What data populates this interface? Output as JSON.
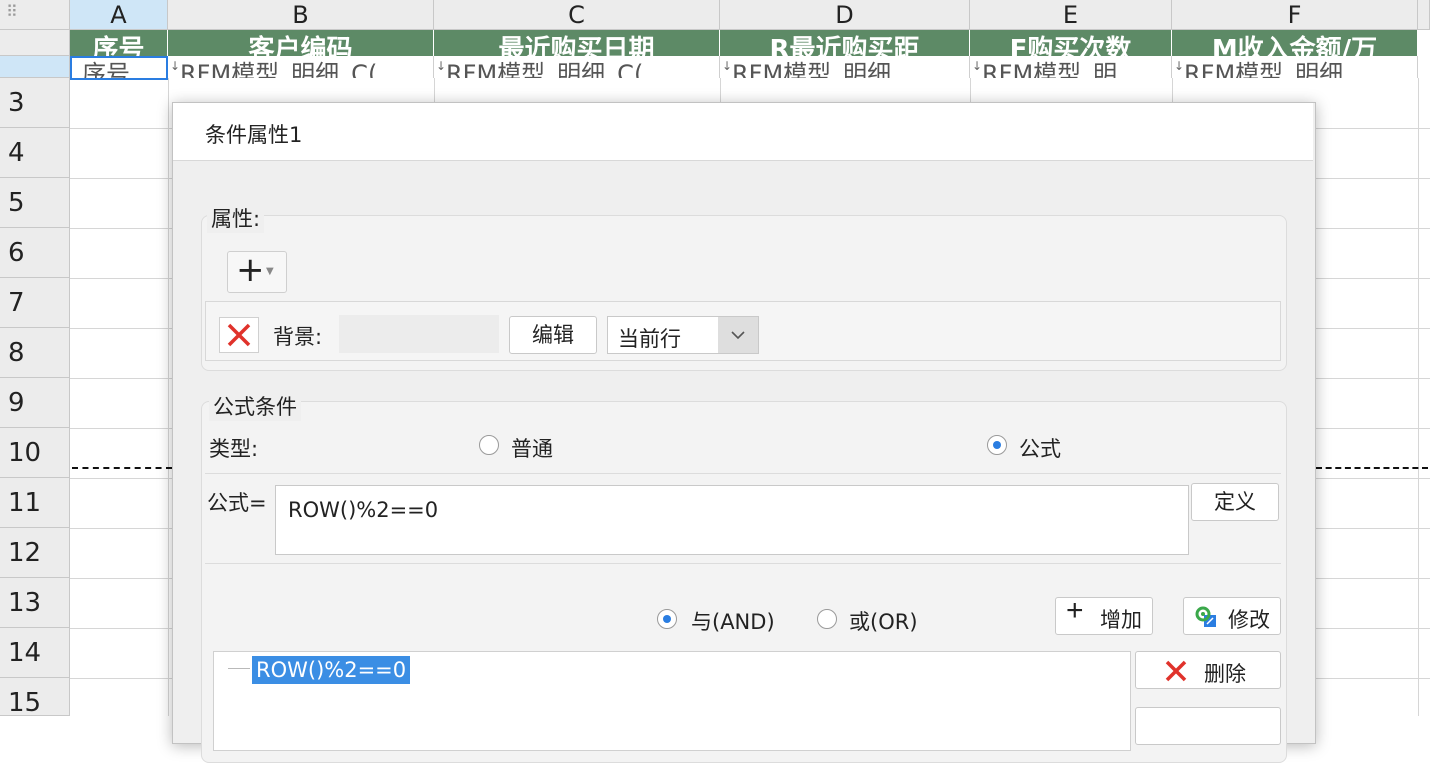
{
  "sheet": {
    "columns": [
      "A",
      "B",
      "C",
      "D",
      "E",
      "F"
    ],
    "rows": [
      "3",
      "4",
      "5",
      "6",
      "7",
      "8",
      "9",
      "10",
      "11",
      "12",
      "13",
      "14",
      "15"
    ],
    "header_cells": [
      "序号",
      "客户编码",
      "最近购买日期",
      "R最近购买距",
      "F购买次数",
      "M收入金额/万"
    ],
    "data_cells": [
      "序号",
      "RFM模型_明细_C(",
      "RFM模型_明细_C(",
      "RFM模型_明细",
      "RFM模型_明",
      "RFM模型_明细"
    ]
  },
  "dialog": {
    "title": "条件属性1",
    "properties": {
      "group_label": "属性:",
      "background_label": "背景:",
      "edit_button": "编辑",
      "scope_value": "当前行"
    },
    "formula": {
      "group_label": "公式条件",
      "type_label": "类型:",
      "type_normal": "普通",
      "type_formula": "公式",
      "selected_type": "公式",
      "formula_label": "公式=",
      "formula_value": "ROW()%2==0",
      "define_button": "定义",
      "and_label": "与(AND)",
      "or_label": "或(OR)",
      "logic_selected": "AND",
      "add_button": "增加",
      "modify_button": "修改",
      "delete_button": "删除",
      "condition_item": "ROW()%2==0"
    }
  },
  "colors": {
    "header_green": "#5d8a66",
    "accent_blue": "#2a7de1",
    "delete_red": "#e0322b"
  }
}
